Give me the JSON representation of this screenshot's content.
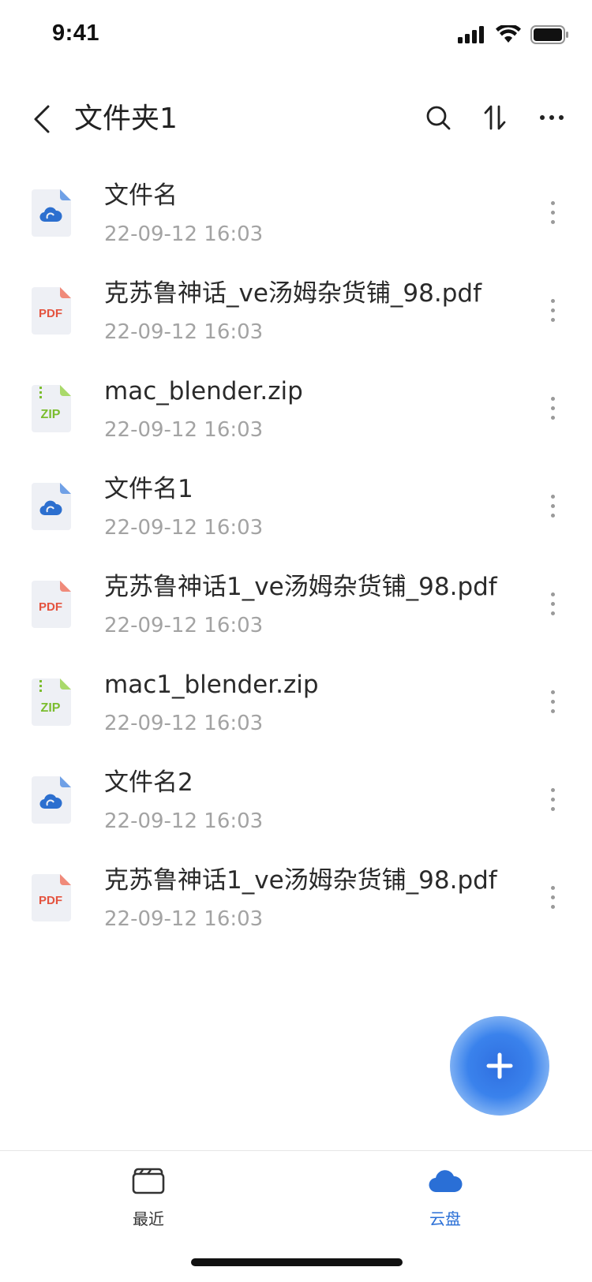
{
  "status_bar": {
    "time": "9:41",
    "icons": [
      "cellular-signal-icon",
      "wifi-icon",
      "battery-icon"
    ]
  },
  "header": {
    "title": "文件夹1",
    "actions": [
      "search-icon",
      "sort-icon",
      "more-icon"
    ]
  },
  "files": [
    {
      "name": "文件名",
      "date": "22-09-12 16:03",
      "type": "cloud",
      "icon": "cloud-file-icon"
    },
    {
      "name": "克苏鲁神话_ve汤姆杂货铺_98.pdf",
      "date": "22-09-12 16:03",
      "type": "pdf",
      "icon": "pdf-file-icon",
      "badge": "PDF"
    },
    {
      "name": "mac_blender.zip",
      "date": "22-09-12 16:03",
      "type": "zip",
      "icon": "zip-file-icon",
      "badge": "ZIP"
    },
    {
      "name": "文件名1",
      "date": "22-09-12 16:03",
      "type": "cloud",
      "icon": "cloud-file-icon"
    },
    {
      "name": "克苏鲁神话1_ve汤姆杂货铺_98.pdf",
      "date": "22-09-12 16:03",
      "type": "pdf",
      "icon": "pdf-file-icon",
      "badge": "PDF"
    },
    {
      "name": "mac1_blender.zip",
      "date": "22-09-12 16:03",
      "type": "zip",
      "icon": "zip-file-icon",
      "badge": "ZIP"
    },
    {
      "name": "文件名2",
      "date": "22-09-12 16:03",
      "type": "cloud",
      "icon": "cloud-file-icon"
    },
    {
      "name": "克苏鲁神话1_ve汤姆杂货铺_98.pdf",
      "date": "22-09-12 16:03",
      "type": "pdf",
      "icon": "pdf-file-icon",
      "badge": "PDF"
    }
  ],
  "fab": {
    "icon": "plus-icon"
  },
  "tab_bar": {
    "tabs": [
      {
        "label": "最近",
        "icon": "recent-folder-icon",
        "active": false
      },
      {
        "label": "云盘",
        "icon": "cloud-icon",
        "active": true
      }
    ]
  },
  "colors": {
    "accent": "#2a6fd6",
    "pdf": "#e4533f",
    "zip": "#7bbd2e",
    "cloud": "#2c6fcf",
    "date_gray": "#a3a3a3"
  }
}
